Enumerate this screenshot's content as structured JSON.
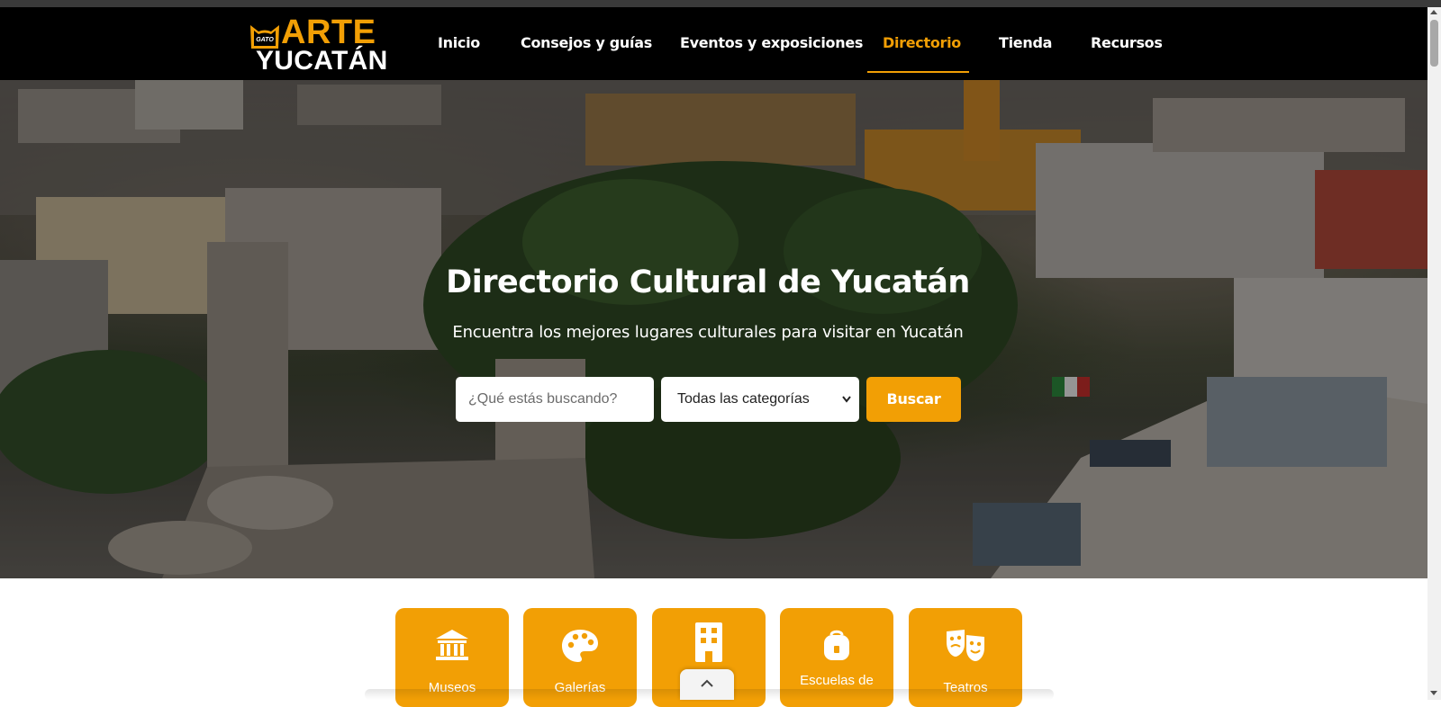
{
  "logo": {
    "top_text": "ARTE",
    "bottom_text": "YUCATÁN",
    "badge_text": "GATO"
  },
  "nav": {
    "items": [
      {
        "label": "Inicio",
        "active": false
      },
      {
        "label": "Consejos y guías",
        "active": false
      },
      {
        "label": "Eventos y exposiciones",
        "active": false
      },
      {
        "label": "Directorio",
        "active": true
      },
      {
        "label": "Tienda",
        "active": false
      },
      {
        "label": "Recursos",
        "active": false
      }
    ]
  },
  "hero": {
    "title": "Directorio Cultural de Yucatán",
    "subtitle": "Encuentra los mejores lugares culturales para visitar en Yucatán",
    "search": {
      "placeholder": "¿Qué estás buscando?",
      "value": ""
    },
    "category_select": {
      "selected": "Todas las categorías"
    },
    "search_button": "Buscar"
  },
  "categories": [
    {
      "label": "Museos",
      "icon": "museum-icon"
    },
    {
      "label": "Galerías",
      "icon": "palette-icon"
    },
    {
      "label": "",
      "icon": "building-icon"
    },
    {
      "label": "Escuelas de",
      "icon": "school-bag-icon"
    },
    {
      "label": "Teatros",
      "icon": "theater-masks-icon"
    }
  ],
  "colors": {
    "accent": "#f29f05",
    "navbar": "#000000",
    "text_light": "#ffffff"
  }
}
